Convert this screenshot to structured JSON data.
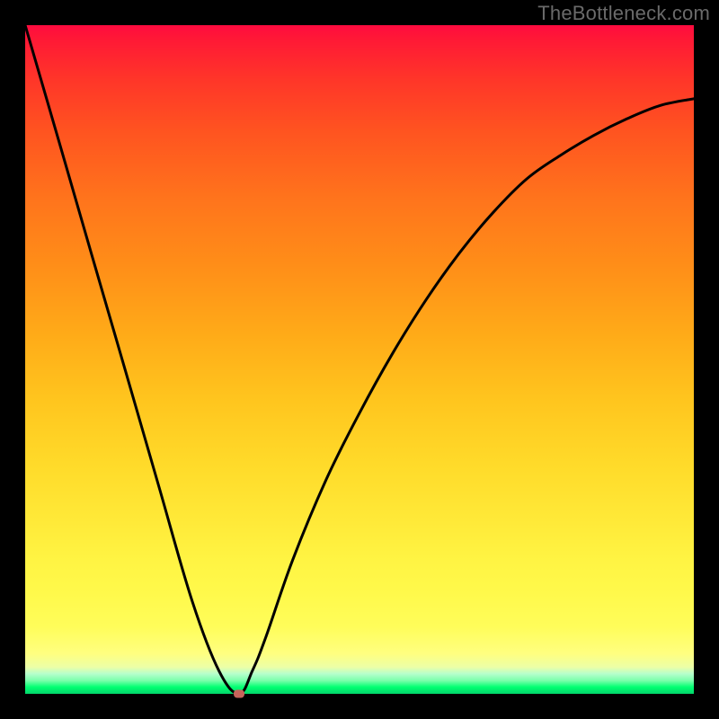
{
  "attribution": "TheBottleneck.com",
  "chart_data": {
    "type": "line",
    "title": "",
    "xlabel": "",
    "ylabel": "",
    "xlim": [
      0,
      100
    ],
    "ylim": [
      0,
      100
    ],
    "grid": false,
    "legend": false,
    "series": [
      {
        "name": "bottleneck-curve",
        "x": [
          0,
          5,
          10,
          15,
          20,
          25,
          29,
          32,
          34,
          36,
          40,
          45,
          50,
          55,
          60,
          65,
          70,
          75,
          80,
          85,
          90,
          95,
          100
        ],
        "values": [
          100,
          82.8,
          65.5,
          48.3,
          31.0,
          13.8,
          3.4,
          0,
          3.5,
          8.5,
          20,
          32,
          42,
          51,
          59,
          66,
          72,
          77,
          80.5,
          83.5,
          86,
          88,
          89
        ]
      }
    ],
    "annotations": [
      {
        "name": "optimal-marker",
        "x": 32,
        "y": 0,
        "color": "#c6645b"
      }
    ],
    "background_gradient": {
      "top": "#ff0b3f",
      "mid": "#ffdb2a",
      "bottom": "#02d66b"
    }
  }
}
